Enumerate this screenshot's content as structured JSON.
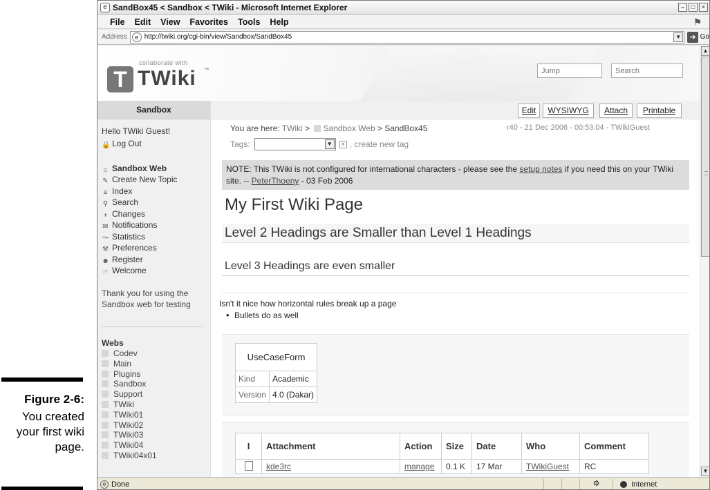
{
  "caption": {
    "figure_label": "Figure 2-6:",
    "text": "You created your first wiki page."
  },
  "window": {
    "title": "SandBox45 < Sandbox < TWiki - Microsoft Internet Explorer",
    "minimize": "–",
    "maximize": "□",
    "close": "×"
  },
  "menu": [
    "File",
    "Edit",
    "View",
    "Favorites",
    "Tools",
    "Help"
  ],
  "address": {
    "label": "Address",
    "url": "http://twiki.org/cgi-bin/view/Sandbox/SandBox45",
    "go": "Go"
  },
  "header": {
    "logo_tagline": "collaborate with",
    "logo_word": "TWiki",
    "logo_tm": "™",
    "jump_placeholder": "Jump",
    "search_placeholder": "Search"
  },
  "sidebar": {
    "title": "Sandbox",
    "hello": "Hello TWiki Guest!",
    "logout": "Log Out",
    "web_name": "Sandbox Web",
    "nav": [
      {
        "label": "Create New Topic",
        "icon": "new-topic-icon",
        "glyph": "✎"
      },
      {
        "label": "Index",
        "icon": "index-icon",
        "glyph": "≡"
      },
      {
        "label": "Search",
        "icon": "search-icon",
        "glyph": "⚲"
      },
      {
        "label": "Changes",
        "icon": "changes-icon",
        "glyph": "+"
      },
      {
        "label": "Notifications",
        "icon": "notify-icon",
        "glyph": "✉"
      },
      {
        "label": "Statistics",
        "icon": "stats-icon",
        "glyph": "〜"
      },
      {
        "label": "Preferences",
        "icon": "wrench-icon",
        "glyph": "⚒"
      },
      {
        "label": "Register",
        "icon": "register-icon",
        "glyph": "☻"
      },
      {
        "label": "Welcome",
        "icon": "welcome-icon",
        "glyph": "☞"
      }
    ],
    "thanks": "Thank you for using the Sandbox web for testing",
    "webs_title": "Webs",
    "webs": [
      "Codev",
      "Main",
      "Plugins",
      "Sandbox",
      "Support",
      "TWiki",
      "TWiki01",
      "TWiki02",
      "TWiki03",
      "TWiki04",
      "TWiki04x01"
    ]
  },
  "actions": {
    "edit": "Edit",
    "wysiwyg": "WYSIWYG",
    "attach": "Attach",
    "printable": "Printable"
  },
  "breadcrumb": {
    "prefix": "You are here:",
    "twiki": "TWiki",
    "sep": ">",
    "web": "Sandbox Web",
    "topic": "SandBox45"
  },
  "revision": "r40 - 21 Dec 2006 - 00:53:04 - TWikiGuest",
  "tags": {
    "label": "Tags:",
    "create": ", create new tag"
  },
  "note": {
    "lead": "NOTE: This TWiki is not configured for international characters - please see the ",
    "link": "setup notes",
    "tail": " if you need this on your TWiki site. -- ",
    "author": "PeterThoeny",
    "date": " - 03 Feb 2006"
  },
  "content": {
    "h1": "My First Wiki Page",
    "h2": "Level 2 Headings are Smaller than Level 1 Headings",
    "h3": "Level 3 Headings are even smaller",
    "paragraph": "Isn't it nice how horizontal rules break up a page",
    "bullet": "Bullets do as well"
  },
  "form": {
    "title": "UseCaseForm",
    "rows": [
      {
        "key": "Kind",
        "value": "Academic"
      },
      {
        "key": "Version",
        "value": "4.0 (Dakar)"
      }
    ]
  },
  "attachments": {
    "headers": [
      "I",
      "Attachment",
      "Action",
      "Size",
      "Date",
      "Who",
      "Comment"
    ],
    "rows": [
      {
        "name": "kde3rc",
        "action": "manage",
        "size": "0.1 K",
        "date": "17 Mar",
        "who": "TWikiGuest",
        "comment": "RC"
      }
    ]
  },
  "status": {
    "text": "Done",
    "zone": "Internet"
  }
}
